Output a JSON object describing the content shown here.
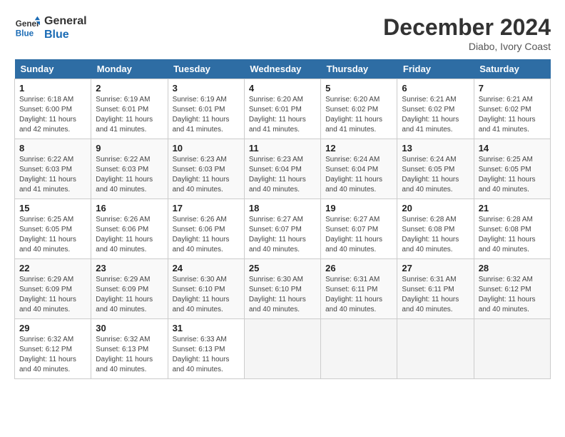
{
  "header": {
    "logo_line1": "General",
    "logo_line2": "Blue",
    "month_title": "December 2024",
    "location": "Diabo, Ivory Coast"
  },
  "days_of_week": [
    "Sunday",
    "Monday",
    "Tuesday",
    "Wednesday",
    "Thursday",
    "Friday",
    "Saturday"
  ],
  "weeks": [
    [
      {
        "day": 1,
        "lines": [
          "Sunrise: 6:18 AM",
          "Sunset: 6:00 PM",
          "Daylight: 11 hours",
          "and 42 minutes."
        ]
      },
      {
        "day": 2,
        "lines": [
          "Sunrise: 6:19 AM",
          "Sunset: 6:01 PM",
          "Daylight: 11 hours",
          "and 41 minutes."
        ]
      },
      {
        "day": 3,
        "lines": [
          "Sunrise: 6:19 AM",
          "Sunset: 6:01 PM",
          "Daylight: 11 hours",
          "and 41 minutes."
        ]
      },
      {
        "day": 4,
        "lines": [
          "Sunrise: 6:20 AM",
          "Sunset: 6:01 PM",
          "Daylight: 11 hours",
          "and 41 minutes."
        ]
      },
      {
        "day": 5,
        "lines": [
          "Sunrise: 6:20 AM",
          "Sunset: 6:02 PM",
          "Daylight: 11 hours",
          "and 41 minutes."
        ]
      },
      {
        "day": 6,
        "lines": [
          "Sunrise: 6:21 AM",
          "Sunset: 6:02 PM",
          "Daylight: 11 hours",
          "and 41 minutes."
        ]
      },
      {
        "day": 7,
        "lines": [
          "Sunrise: 6:21 AM",
          "Sunset: 6:02 PM",
          "Daylight: 11 hours",
          "and 41 minutes."
        ]
      }
    ],
    [
      {
        "day": 8,
        "lines": [
          "Sunrise: 6:22 AM",
          "Sunset: 6:03 PM",
          "Daylight: 11 hours",
          "and 41 minutes."
        ]
      },
      {
        "day": 9,
        "lines": [
          "Sunrise: 6:22 AM",
          "Sunset: 6:03 PM",
          "Daylight: 11 hours",
          "and 40 minutes."
        ]
      },
      {
        "day": 10,
        "lines": [
          "Sunrise: 6:23 AM",
          "Sunset: 6:03 PM",
          "Daylight: 11 hours",
          "and 40 minutes."
        ]
      },
      {
        "day": 11,
        "lines": [
          "Sunrise: 6:23 AM",
          "Sunset: 6:04 PM",
          "Daylight: 11 hours",
          "and 40 minutes."
        ]
      },
      {
        "day": 12,
        "lines": [
          "Sunrise: 6:24 AM",
          "Sunset: 6:04 PM",
          "Daylight: 11 hours",
          "and 40 minutes."
        ]
      },
      {
        "day": 13,
        "lines": [
          "Sunrise: 6:24 AM",
          "Sunset: 6:05 PM",
          "Daylight: 11 hours",
          "and 40 minutes."
        ]
      },
      {
        "day": 14,
        "lines": [
          "Sunrise: 6:25 AM",
          "Sunset: 6:05 PM",
          "Daylight: 11 hours",
          "and 40 minutes."
        ]
      }
    ],
    [
      {
        "day": 15,
        "lines": [
          "Sunrise: 6:25 AM",
          "Sunset: 6:05 PM",
          "Daylight: 11 hours",
          "and 40 minutes."
        ]
      },
      {
        "day": 16,
        "lines": [
          "Sunrise: 6:26 AM",
          "Sunset: 6:06 PM",
          "Daylight: 11 hours",
          "and 40 minutes."
        ]
      },
      {
        "day": 17,
        "lines": [
          "Sunrise: 6:26 AM",
          "Sunset: 6:06 PM",
          "Daylight: 11 hours",
          "and 40 minutes."
        ]
      },
      {
        "day": 18,
        "lines": [
          "Sunrise: 6:27 AM",
          "Sunset: 6:07 PM",
          "Daylight: 11 hours",
          "and 40 minutes."
        ]
      },
      {
        "day": 19,
        "lines": [
          "Sunrise: 6:27 AM",
          "Sunset: 6:07 PM",
          "Daylight: 11 hours",
          "and 40 minutes."
        ]
      },
      {
        "day": 20,
        "lines": [
          "Sunrise: 6:28 AM",
          "Sunset: 6:08 PM",
          "Daylight: 11 hours",
          "and 40 minutes."
        ]
      },
      {
        "day": 21,
        "lines": [
          "Sunrise: 6:28 AM",
          "Sunset: 6:08 PM",
          "Daylight: 11 hours",
          "and 40 minutes."
        ]
      }
    ],
    [
      {
        "day": 22,
        "lines": [
          "Sunrise: 6:29 AM",
          "Sunset: 6:09 PM",
          "Daylight: 11 hours",
          "and 40 minutes."
        ]
      },
      {
        "day": 23,
        "lines": [
          "Sunrise: 6:29 AM",
          "Sunset: 6:09 PM",
          "Daylight: 11 hours",
          "and 40 minutes."
        ]
      },
      {
        "day": 24,
        "lines": [
          "Sunrise: 6:30 AM",
          "Sunset: 6:10 PM",
          "Daylight: 11 hours",
          "and 40 minutes."
        ]
      },
      {
        "day": 25,
        "lines": [
          "Sunrise: 6:30 AM",
          "Sunset: 6:10 PM",
          "Daylight: 11 hours",
          "and 40 minutes."
        ]
      },
      {
        "day": 26,
        "lines": [
          "Sunrise: 6:31 AM",
          "Sunset: 6:11 PM",
          "Daylight: 11 hours",
          "and 40 minutes."
        ]
      },
      {
        "day": 27,
        "lines": [
          "Sunrise: 6:31 AM",
          "Sunset: 6:11 PM",
          "Daylight: 11 hours",
          "and 40 minutes."
        ]
      },
      {
        "day": 28,
        "lines": [
          "Sunrise: 6:32 AM",
          "Sunset: 6:12 PM",
          "Daylight: 11 hours",
          "and 40 minutes."
        ]
      }
    ],
    [
      {
        "day": 29,
        "lines": [
          "Sunrise: 6:32 AM",
          "Sunset: 6:12 PM",
          "Daylight: 11 hours",
          "and 40 minutes."
        ]
      },
      {
        "day": 30,
        "lines": [
          "Sunrise: 6:32 AM",
          "Sunset: 6:13 PM",
          "Daylight: 11 hours",
          "and 40 minutes."
        ]
      },
      {
        "day": 31,
        "lines": [
          "Sunrise: 6:33 AM",
          "Sunset: 6:13 PM",
          "Daylight: 11 hours",
          "and 40 minutes."
        ]
      },
      null,
      null,
      null,
      null
    ]
  ]
}
